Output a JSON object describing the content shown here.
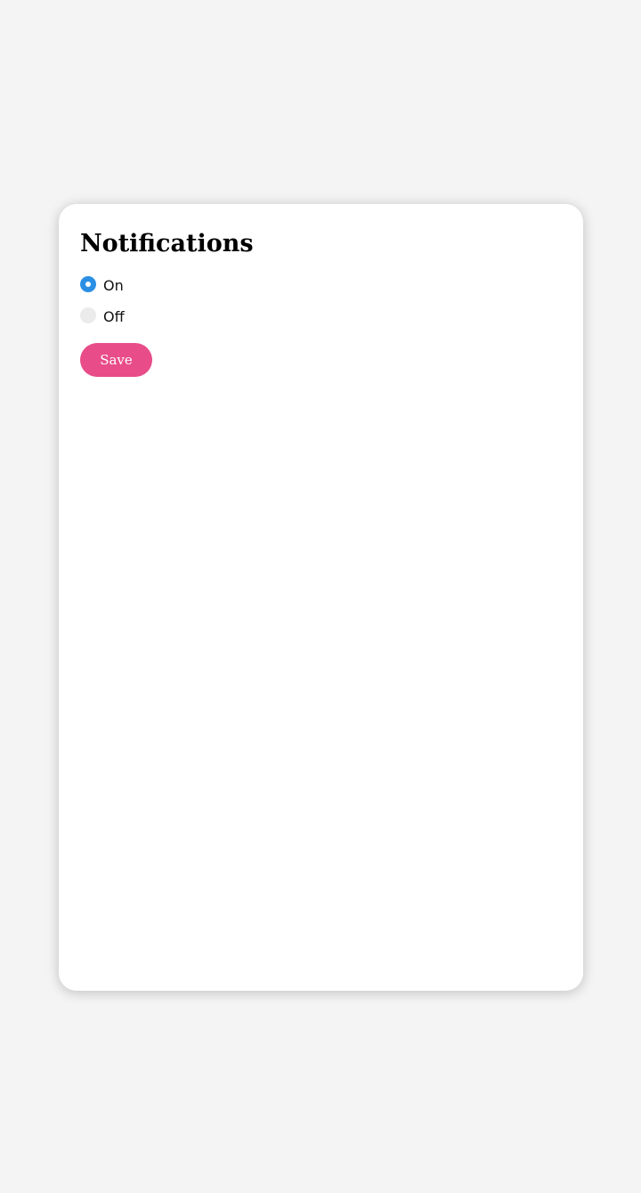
{
  "card": {
    "title": "Notifications",
    "options": [
      {
        "label": "On",
        "checked": true
      },
      {
        "label": "Off",
        "checked": false
      }
    ],
    "save_label": "Save"
  },
  "colors": {
    "accent_radio": "#2a8fe4",
    "save_button": "#e84c89",
    "page_background": "#f4f4f4",
    "card_background": "#ffffff"
  }
}
